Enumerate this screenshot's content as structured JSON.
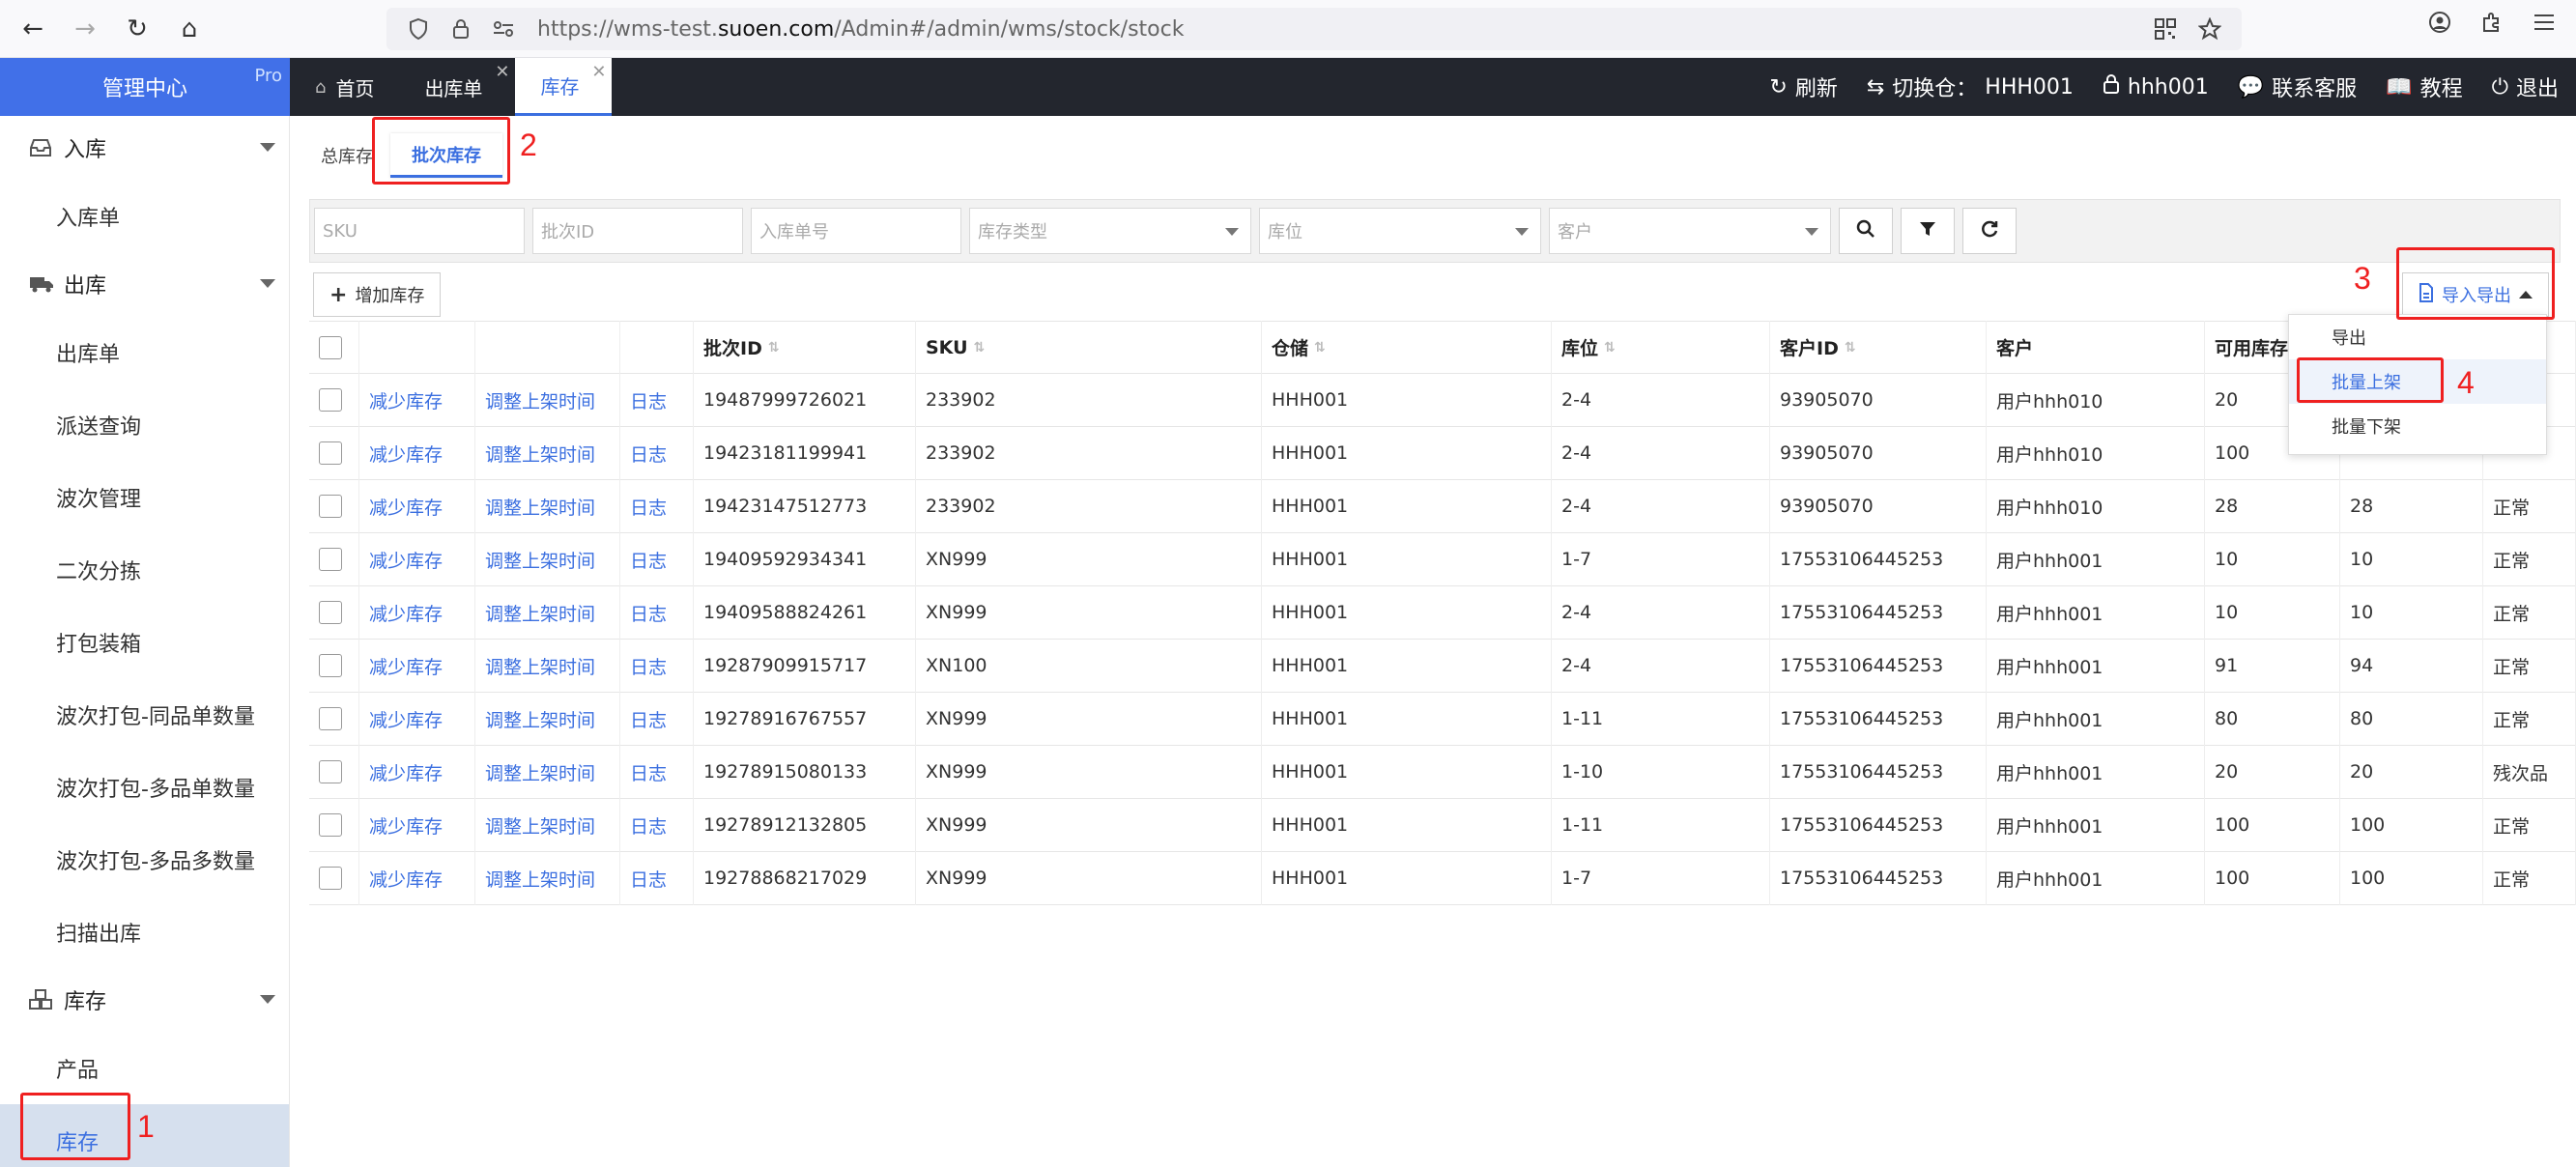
{
  "browser": {
    "url_prefix": "https://wms-test.",
    "url_domain": "suoen.com",
    "url_path": "/Admin#/admin/wms/stock/stock"
  },
  "app": {
    "brand": "管理中心",
    "brand_badge": "Pro",
    "tabs": [
      {
        "label": "首页"
      },
      {
        "label": "出库单"
      },
      {
        "label": "库存"
      }
    ],
    "top_right": {
      "refresh": "刷新",
      "switch_label": "切换仓：",
      "warehouse": "HHH001",
      "user": "hhh001",
      "support": "联系客服",
      "tutorial": "教程",
      "logout": "退出"
    }
  },
  "sidebar": {
    "groups": [
      {
        "label": "入库",
        "items": [
          "入库单"
        ]
      },
      {
        "label": "出库",
        "items": [
          "出库单",
          "派送查询",
          "波次管理",
          "二次分拣",
          "打包装箱",
          "波次打包-同品单数量",
          "波次打包-多品单数量",
          "波次打包-多品多数量",
          "扫描出库"
        ]
      },
      {
        "label": "库存",
        "items": [
          "产品",
          "库存"
        ]
      }
    ]
  },
  "subtabs": [
    "总库存",
    "批次库存"
  ],
  "filters": {
    "sku": "SKU",
    "batch_id": "批次ID",
    "inbound_no": "入库单号",
    "stock_type": "库存类型",
    "location": "库位",
    "customer": "客户"
  },
  "toolbar": {
    "add": "增加库存",
    "import_export": "导入导出"
  },
  "menu": [
    "导出",
    "批量上架",
    "批量下架"
  ],
  "table": {
    "headers": [
      "批次ID",
      "SKU",
      "仓储",
      "库位",
      "客户ID",
      "客户",
      "可用库存"
    ],
    "row_actions": [
      "减少库存",
      "调整上架时间",
      "日志"
    ],
    "rows": [
      {
        "batch": "19487999726021",
        "sku": "233902",
        "wh": "HHH001",
        "loc": "2-4",
        "cid": "93905070",
        "cust": "用户hhh010",
        "avail": "20",
        "qty": "",
        "status": ""
      },
      {
        "batch": "19423181199941",
        "sku": "233902",
        "wh": "HHH001",
        "loc": "2-4",
        "cid": "93905070",
        "cust": "用户hhh010",
        "avail": "100",
        "qty": "",
        "status": ""
      },
      {
        "batch": "19423147512773",
        "sku": "233902",
        "wh": "HHH001",
        "loc": "2-4",
        "cid": "93905070",
        "cust": "用户hhh010",
        "avail": "28",
        "qty": "28",
        "status": "正常"
      },
      {
        "batch": "19409592934341",
        "sku": "XN999",
        "wh": "HHH001",
        "loc": "1-7",
        "cid": "17553106445253",
        "cust": "用户hhh001",
        "avail": "10",
        "qty": "10",
        "status": "正常"
      },
      {
        "batch": "19409588824261",
        "sku": "XN999",
        "wh": "HHH001",
        "loc": "2-4",
        "cid": "17553106445253",
        "cust": "用户hhh001",
        "avail": "10",
        "qty": "10",
        "status": "正常"
      },
      {
        "batch": "19287909915717",
        "sku": "XN100",
        "wh": "HHH001",
        "loc": "2-4",
        "cid": "17553106445253",
        "cust": "用户hhh001",
        "avail": "91",
        "qty": "94",
        "status": "正常"
      },
      {
        "batch": "19278916767557",
        "sku": "XN999",
        "wh": "HHH001",
        "loc": "1-11",
        "cid": "17553106445253",
        "cust": "用户hhh001",
        "avail": "80",
        "qty": "80",
        "status": "正常"
      },
      {
        "batch": "19278915080133",
        "sku": "XN999",
        "wh": "HHH001",
        "loc": "1-10",
        "cid": "17553106445253",
        "cust": "用户hhh001",
        "avail": "20",
        "qty": "20",
        "status": "残次品"
      },
      {
        "batch": "19278912132805",
        "sku": "XN999",
        "wh": "HHH001",
        "loc": "1-11",
        "cid": "17553106445253",
        "cust": "用户hhh001",
        "avail": "100",
        "qty": "100",
        "status": "正常"
      },
      {
        "batch": "19278868217029",
        "sku": "XN999",
        "wh": "HHH001",
        "loc": "1-7",
        "cid": "17553106445253",
        "cust": "用户hhh001",
        "avail": "100",
        "qty": "100",
        "status": "正常"
      }
    ]
  },
  "annotations": [
    "1",
    "2",
    "3",
    "4"
  ]
}
